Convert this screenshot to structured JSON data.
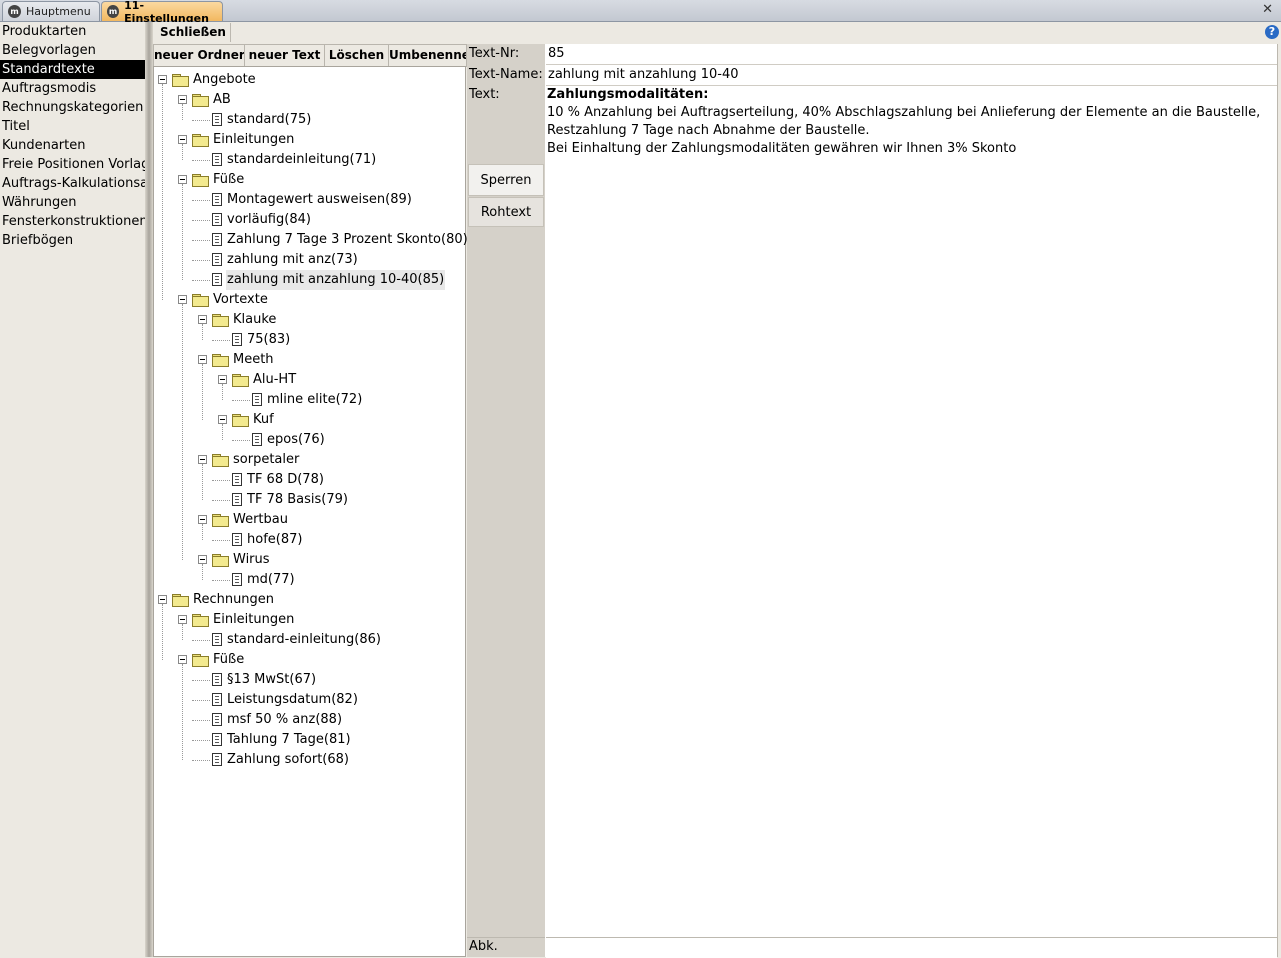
{
  "tabs": [
    {
      "label": "Hauptmenu",
      "active": false
    },
    {
      "label": "11-Einstellungen",
      "active": true
    }
  ],
  "close_symbol": "✕",
  "help_symbol": "?",
  "nav": {
    "items": [
      {
        "label": "Produktarten",
        "selected": false
      },
      {
        "label": "Belegvorlagen",
        "selected": false
      },
      {
        "label": "Standardtexte",
        "selected": true
      },
      {
        "label": "Auftragsmodis",
        "selected": false
      },
      {
        "label": "Rechnungskategorien",
        "selected": false
      },
      {
        "label": "Titel",
        "selected": false
      },
      {
        "label": "Kundenarten",
        "selected": false
      },
      {
        "label": "Freie Positionen Vorlagen",
        "selected": false
      },
      {
        "label": "Auftrags-Kalkulationsansichten",
        "selected": false
      },
      {
        "label": "Währungen",
        "selected": false
      },
      {
        "label": "Fensterkonstruktionen",
        "selected": false
      },
      {
        "label": "Briefbögen",
        "selected": false
      }
    ]
  },
  "header": {
    "close_label": "Schließen"
  },
  "toolbar": {
    "buttons": [
      "neuer Ordner",
      "neuer Text",
      "Löschen",
      "Umbenennen"
    ]
  },
  "tree": [
    {
      "label": "Angebote",
      "type": "folder",
      "level": 0
    },
    {
      "label": "AB",
      "type": "folder",
      "level": 1
    },
    {
      "label": "standard(75)",
      "type": "doc",
      "level": 2
    },
    {
      "label": "Einleitungen",
      "type": "folder",
      "level": 1
    },
    {
      "label": "standardeinleitung(71)",
      "type": "doc",
      "level": 2
    },
    {
      "label": "Füße",
      "type": "folder",
      "level": 1
    },
    {
      "label": "Montagewert ausweisen(89)",
      "type": "doc",
      "level": 2
    },
    {
      "label": "vorläufig(84)",
      "type": "doc",
      "level": 2
    },
    {
      "label": "Zahlung 7 Tage 3 Prozent Skonto(80)",
      "type": "doc",
      "level": 2
    },
    {
      "label": "zahlung mit anz(73)",
      "type": "doc",
      "level": 2
    },
    {
      "label": "zahlung mit anzahlung 10-40(85)",
      "type": "doc",
      "level": 2,
      "selected": true
    },
    {
      "label": "Vortexte",
      "type": "folder",
      "level": 1
    },
    {
      "label": "Klauke",
      "type": "folder",
      "level": 2
    },
    {
      "label": "75(83)",
      "type": "doc",
      "level": 3
    },
    {
      "label": "Meeth",
      "type": "folder",
      "level": 2
    },
    {
      "label": "Alu-HT",
      "type": "folder",
      "level": 3
    },
    {
      "label": "mline elite(72)",
      "type": "doc",
      "level": 4
    },
    {
      "label": "Kuf",
      "type": "folder",
      "level": 3
    },
    {
      "label": "epos(76)",
      "type": "doc",
      "level": 4
    },
    {
      "label": "sorpetaler",
      "type": "folder",
      "level": 2
    },
    {
      "label": "TF 68 D(78)",
      "type": "doc",
      "level": 3
    },
    {
      "label": "TF 78 Basis(79)",
      "type": "doc",
      "level": 3
    },
    {
      "label": "Wertbau",
      "type": "folder",
      "level": 2
    },
    {
      "label": "hofe(87)",
      "type": "doc",
      "level": 3
    },
    {
      "label": "Wirus",
      "type": "folder",
      "level": 2
    },
    {
      "label": "md(77)",
      "type": "doc",
      "level": 3
    },
    {
      "label": "Rechnungen",
      "type": "folder",
      "level": 0
    },
    {
      "label": "Einleitungen",
      "type": "folder",
      "level": 1
    },
    {
      "label": "standard-einleitung(86)",
      "type": "doc",
      "level": 2
    },
    {
      "label": "Füße",
      "type": "folder",
      "level": 1
    },
    {
      "label": "§13 MwSt(67)",
      "type": "doc",
      "level": 2
    },
    {
      "label": "Leistungsdatum(82)",
      "type": "doc",
      "level": 2
    },
    {
      "label": "msf 50 % anz(88)",
      "type": "doc",
      "level": 2
    },
    {
      "label": "Tahlung 7 Tage(81)",
      "type": "doc",
      "level": 2
    },
    {
      "label": "Zahlung sofort(68)",
      "type": "doc",
      "level": 2
    }
  ],
  "form": {
    "nr_label": "Text-Nr:",
    "nr_value": "85",
    "name_label": "Text-Name:",
    "name_value": "zahlung mit anzahlung 10-40",
    "text_label": "Text:",
    "sperren_label": "Sperren",
    "rohtext_label": "Rohtext",
    "abk_label": "Abk.",
    "abk_value": "",
    "text_lines": [
      {
        "text": "Zahlungsmodalitäten:",
        "bold": true
      },
      {
        "text": "10 % Anzahlung bei Auftragserteilung, 40% Abschlagszahlung bei Anlieferung der Elemente an die Baustelle,",
        "bold": false
      },
      {
        "text": "Restzahlung 7 Tage nach Abnahme der Baustelle.",
        "bold": false
      },
      {
        "text": "Bei Einhaltung der Zahlungsmodalitäten gewähren wir Ihnen 3% Skonto",
        "bold": false
      }
    ]
  }
}
